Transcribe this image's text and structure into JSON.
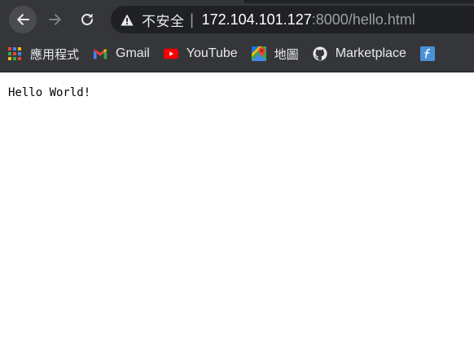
{
  "browser": {
    "security_label": "不安全",
    "security_icon": "warning-triangle-icon",
    "url_host": "172.104.101.127",
    "url_rest": ":8000/hello.html",
    "nav": {
      "back_icon": "back-arrow-icon",
      "forward_icon": "forward-arrow-icon",
      "reload_icon": "reload-icon"
    }
  },
  "bookmarks": [
    {
      "label": "應用程式",
      "icon": "apps-grid-icon"
    },
    {
      "label": "Gmail",
      "icon": "gmail-icon"
    },
    {
      "label": "YouTube",
      "icon": "youtube-icon"
    },
    {
      "label": "地圖",
      "icon": "maps-icon"
    },
    {
      "label": "Marketplace",
      "icon": "github-icon"
    },
    {
      "label": "",
      "icon": "flash-f-icon"
    }
  ],
  "page": {
    "body_text": "Hello World!"
  },
  "colors": {
    "toolbar_bg": "#35363a",
    "omnibox_bg": "#202124",
    "text_light": "#e8eaed",
    "url_dim": "#9aa0a6"
  }
}
